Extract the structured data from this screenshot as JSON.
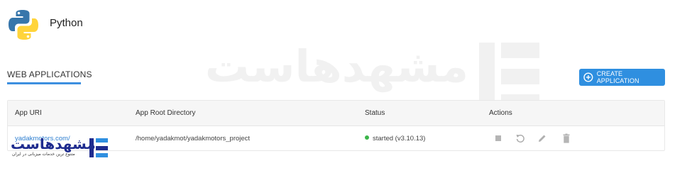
{
  "header": {
    "title": "Python",
    "logo_icon": "python-logo-icon"
  },
  "watermark": {
    "main": "مشهدهاست",
    "tagline": "متنوع ترین خدمات میزبانی در ایران"
  },
  "section": {
    "tab_label": "WEB APPLICATIONS",
    "create_button_label": "CREATE APPLICATION",
    "create_button_icon": "plus-circle-icon"
  },
  "table": {
    "columns": [
      "App URI",
      "App Root Directory",
      "Status",
      "Actions"
    ],
    "rows": [
      {
        "uri": "yadakmotors.com/",
        "root_dir": "/home/yadakmot/yadakmotors_project",
        "status": "started (v3.10.13)",
        "actions": [
          "stop-icon",
          "restart-icon",
          "edit-icon",
          "delete-icon"
        ]
      }
    ]
  },
  "brand": {
    "name": "مشهدهاست",
    "tagline": "متنوع ترین خدمات میزبانی در ایران"
  },
  "colors": {
    "accent": "#2f8fe0",
    "link": "#2f7fd0",
    "status_ok": "#3bb54a",
    "brand": "#1f2c8f"
  }
}
